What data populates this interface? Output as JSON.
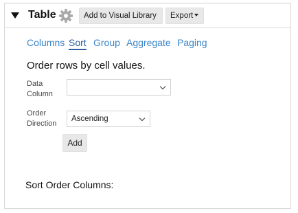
{
  "panel": {
    "title": "Table",
    "buttons": {
      "add_to_library": "Add to Visual Library",
      "export": "Export"
    }
  },
  "tabs": [
    {
      "label": "Columns",
      "active": false
    },
    {
      "label": "Sort",
      "active": true
    },
    {
      "label": "Group",
      "active": false
    },
    {
      "label": "Aggregate",
      "active": false
    },
    {
      "label": "Paging",
      "active": false
    }
  ],
  "sort": {
    "heading": "Order rows by cell values.",
    "data_column": {
      "label_line1": "Data",
      "label_line2": "Column",
      "value": ""
    },
    "order_direction": {
      "label_line1": "Order",
      "label_line2": "Direction",
      "value": "Ascending"
    },
    "add_label": "Add",
    "sort_order_heading": "Sort Order Columns:"
  },
  "colors": {
    "tab_link": "#3a84c9",
    "tab_active": "#2b5f9e",
    "button_bg": "#e8e8e8",
    "gear": "#a9a9a9"
  }
}
